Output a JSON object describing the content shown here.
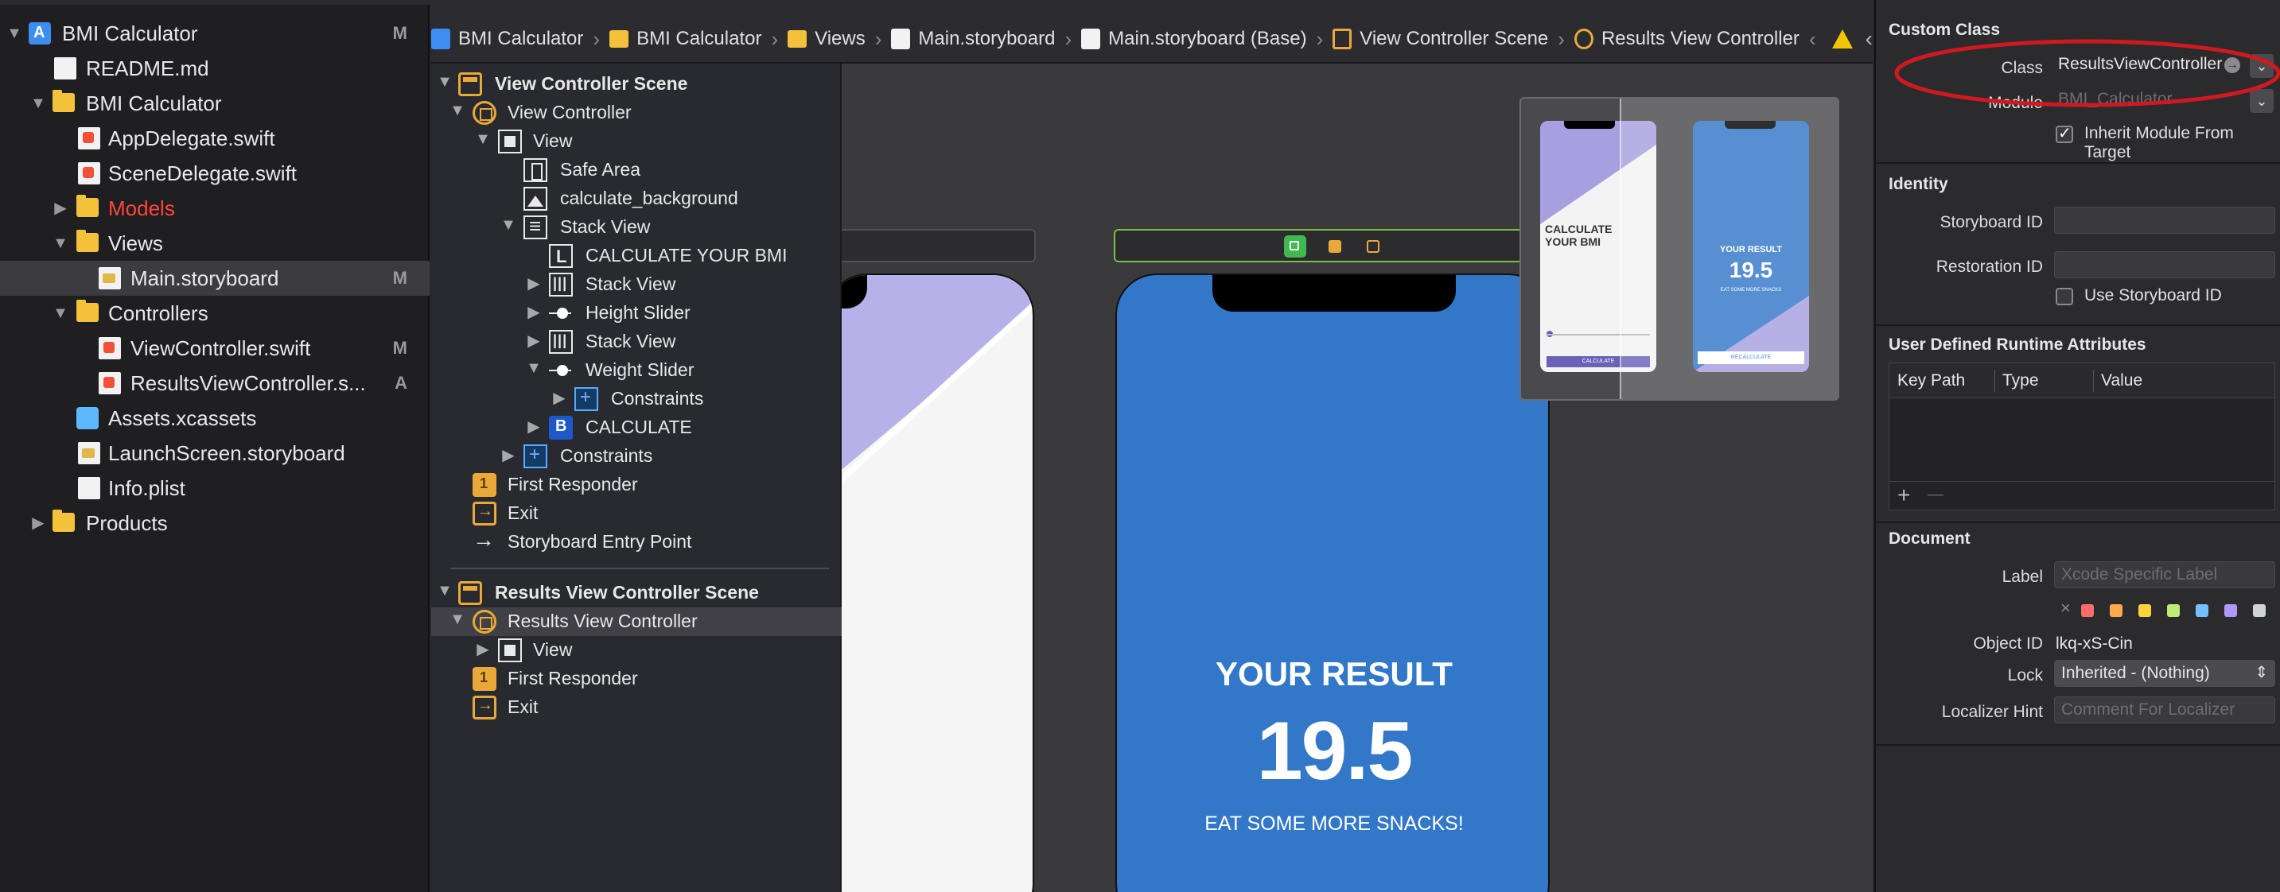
{
  "navigator": {
    "items": [
      {
        "label": "BMI Calculator",
        "badge": "M",
        "kind": "project"
      },
      {
        "label": "README.md",
        "badge": "",
        "kind": "file"
      },
      {
        "label": "BMI Calculator",
        "badge": "",
        "kind": "folder"
      },
      {
        "label": "AppDelegate.swift",
        "badge": "",
        "kind": "swift"
      },
      {
        "label": "SceneDelegate.swift",
        "badge": "",
        "kind": "swift"
      },
      {
        "label": "Models",
        "badge": "",
        "kind": "folder",
        "color": "#ff453a"
      },
      {
        "label": "Views",
        "badge": "",
        "kind": "folder"
      },
      {
        "label": "Main.storyboard",
        "badge": "M",
        "kind": "storyboard"
      },
      {
        "label": "Controllers",
        "badge": "",
        "kind": "folder"
      },
      {
        "label": "ViewController.swift",
        "badge": "M",
        "kind": "swift"
      },
      {
        "label": "ResultsViewController.s...",
        "badge": "A",
        "kind": "swift"
      },
      {
        "label": "Assets.xcassets",
        "badge": "",
        "kind": "assets"
      },
      {
        "label": "LaunchScreen.storyboard",
        "badge": "",
        "kind": "storyboard"
      },
      {
        "label": "Info.plist",
        "badge": "",
        "kind": "plist"
      },
      {
        "label": "Products",
        "badge": "",
        "kind": "folder"
      }
    ]
  },
  "jumpbar": {
    "items": [
      "BMI Calculator",
      "BMI Calculator",
      "Views",
      "Main.storyboard",
      "Main.storyboard (Base)",
      "View Controller Scene",
      "Results View Controller"
    ]
  },
  "outline": {
    "vc_scene": "View Controller Scene",
    "view_controller": "View Controller",
    "view": "View",
    "safe_area": "Safe Area",
    "background": "calculate_background",
    "stack_view": "Stack View",
    "calc_label": "CALCULATE YOUR BMI",
    "stack_view_2": "Stack View",
    "height_slider": "Height Slider",
    "stack_view_3": "Stack View",
    "weight_slider": "Weight Slider",
    "constraints_inner": "Constraints",
    "calculate": "CALCULATE",
    "constraints": "Constraints",
    "first_responder": "First Responder",
    "exit": "Exit",
    "entry_point": "Storyboard Entry Point",
    "results_scene": "Results View Controller Scene",
    "results_vc": "Results View Controller",
    "results_view": "View",
    "results_first_responder": "First Responder",
    "results_exit": "Exit"
  },
  "canvas": {
    "result_title": "YOUR RESULT",
    "result_value": "19.5",
    "result_advice": "EAT SOME MORE SNACKS!",
    "result_bg": "#3277c8",
    "minimap": {
      "calc_title": "CALCULATE YOUR BMI",
      "calc_button": "CALCULATE",
      "result_title": "YOUR RESULT",
      "result_value": "19.5",
      "result_advice": "EAT SOME MORE SNACKS",
      "recalc_button": "RECALCULATE"
    }
  },
  "inspector": {
    "custom_class": {
      "title": "Custom Class",
      "class_label": "Class",
      "class_value": "ResultsViewController",
      "module_label": "Module",
      "module_value": "BMI_Calculator",
      "inherit_label": "Inherit Module From Target"
    },
    "identity": {
      "title": "Identity",
      "storyboard_id_label": "Storyboard ID",
      "restoration_id_label": "Restoration ID",
      "use_storyboard_id_label": "Use Storyboard ID"
    },
    "runtime_attributes": {
      "title": "User Defined Runtime Attributes",
      "columns": [
        "Key Path",
        "Type",
        "Value"
      ],
      "add": "+",
      "remove": "—"
    },
    "document": {
      "title": "Document",
      "label_label": "Label",
      "label_placeholder": "Xcode Specific Label",
      "clear": "×",
      "swatches": [
        "#ff6b6b",
        "#ffa94d",
        "#ffd43b",
        "#c0eb75",
        "#74c0fc",
        "#b197fc",
        "#ced4da"
      ],
      "object_id_label": "Object ID",
      "object_id_value": "lkq-xS-Cin",
      "lock_label": "Lock",
      "lock_value": "Inherited - (Nothing)",
      "localizer_label": "Localizer Hint",
      "localizer_placeholder": "Comment For Localizer"
    }
  },
  "colors": {
    "highlight_ellipse": "#d0191f",
    "accent": "#e9a93a"
  }
}
